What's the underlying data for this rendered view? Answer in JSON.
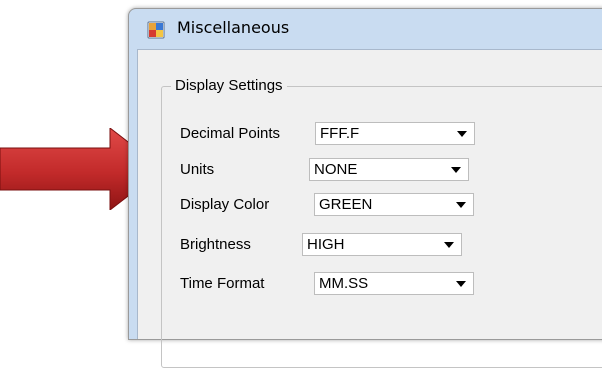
{
  "window": {
    "title": "Miscellaneous",
    "icon": "application-icon"
  },
  "group": {
    "legend": "Display Settings",
    "rows": [
      {
        "label": "Decimal Points",
        "value": "FFF.F"
      },
      {
        "label": "Units",
        "value": "NONE"
      },
      {
        "label": "Display Color",
        "value": "GREEN"
      },
      {
        "label": "Brightness",
        "value": "HIGH"
      },
      {
        "label": "Time Format",
        "value": "MM.SS"
      }
    ]
  },
  "annotation": {
    "icon": "red-arrow-icon",
    "color": "#c0282a"
  }
}
